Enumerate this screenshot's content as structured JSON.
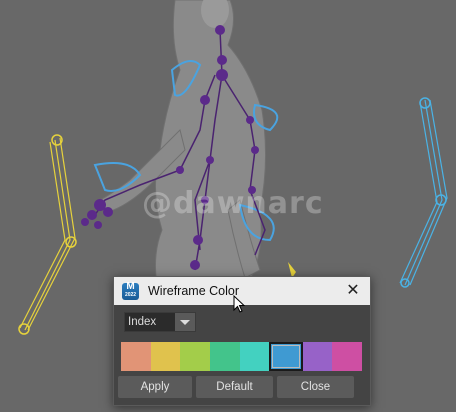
{
  "viewport": {
    "watermark": "@dawnarc"
  },
  "dialog": {
    "title": "Wireframe Color",
    "app_icon_label": "M",
    "app_icon_sub": "2022",
    "mode_select": {
      "selected": "Index"
    },
    "swatches": [
      {
        "color": "#e19476",
        "selected": false
      },
      {
        "color": "#e0c24d",
        "selected": false
      },
      {
        "color": "#a3cd4a",
        "selected": false
      },
      {
        "color": "#43c48b",
        "selected": false
      },
      {
        "color": "#43d1c0",
        "selected": false
      },
      {
        "color": "#3f9ad2",
        "selected": true
      },
      {
        "color": "#9762c8",
        "selected": false
      },
      {
        "color": "#ce4fa3",
        "selected": false
      }
    ],
    "buttons": {
      "apply": "Apply",
      "default": "Default",
      "close": "Close"
    }
  }
}
